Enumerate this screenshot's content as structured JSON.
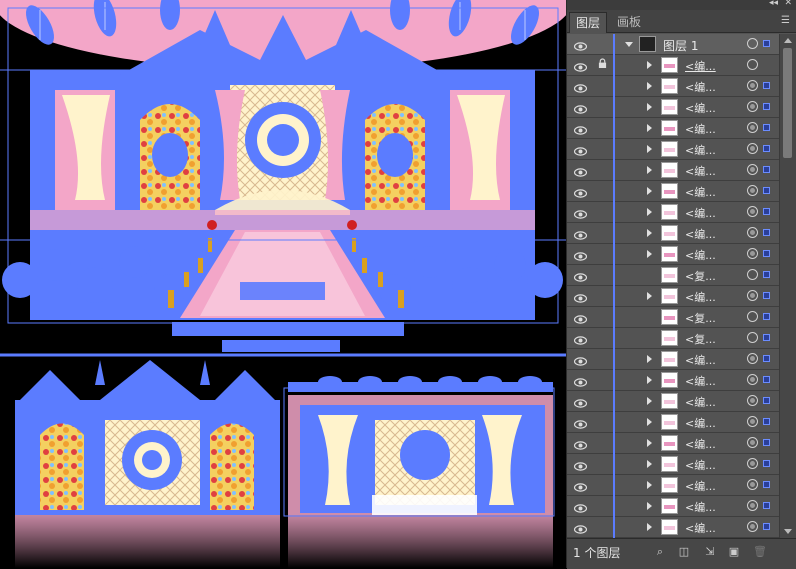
{
  "panel": {
    "tabs": [
      {
        "label": "图层"
      },
      {
        "label": "画板"
      }
    ],
    "window_controls": {
      "collapse": "◂◂",
      "close": "✕"
    },
    "menu_icon": "panel-menu-icon",
    "top_layer": {
      "name": "图层  1"
    },
    "rows": [
      {
        "label": "<编...",
        "locked": true,
        "target": "empty",
        "selected": false,
        "expandable": true,
        "underline": true
      },
      {
        "label": "<编...",
        "locked": false,
        "target": "filled",
        "selected": true,
        "expandable": true,
        "underline": false
      },
      {
        "label": "<编...",
        "locked": false,
        "target": "filled",
        "selected": true,
        "expandable": true,
        "underline": false
      },
      {
        "label": "<编...",
        "locked": false,
        "target": "filled",
        "selected": true,
        "expandable": true,
        "underline": false
      },
      {
        "label": "<编...",
        "locked": false,
        "target": "filled",
        "selected": true,
        "expandable": true,
        "underline": false
      },
      {
        "label": "<编...",
        "locked": false,
        "target": "filled",
        "selected": true,
        "expandable": true,
        "underline": false
      },
      {
        "label": "<编...",
        "locked": false,
        "target": "filled",
        "selected": true,
        "expandable": true,
        "underline": false
      },
      {
        "label": "<编...",
        "locked": false,
        "target": "filled",
        "selected": true,
        "expandable": true,
        "underline": false
      },
      {
        "label": "<编...",
        "locked": false,
        "target": "filled",
        "selected": true,
        "expandable": true,
        "underline": false
      },
      {
        "label": "<编...",
        "locked": false,
        "target": "filled",
        "selected": true,
        "expandable": true,
        "underline": false
      },
      {
        "label": "<复...",
        "locked": false,
        "target": "empty",
        "selected": true,
        "expandable": false,
        "underline": false
      },
      {
        "label": "<编...",
        "locked": false,
        "target": "filled",
        "selected": true,
        "expandable": true,
        "underline": false
      },
      {
        "label": "<复...",
        "locked": false,
        "target": "empty",
        "selected": true,
        "expandable": false,
        "underline": false
      },
      {
        "label": "<复...",
        "locked": false,
        "target": "empty",
        "selected": true,
        "expandable": false,
        "underline": false
      },
      {
        "label": "<编...",
        "locked": false,
        "target": "filled",
        "selected": true,
        "expandable": true,
        "underline": false
      },
      {
        "label": "<编...",
        "locked": false,
        "target": "filled",
        "selected": true,
        "expandable": true,
        "underline": false
      },
      {
        "label": "<编...",
        "locked": false,
        "target": "filled",
        "selected": true,
        "expandable": true,
        "underline": false
      },
      {
        "label": "<编...",
        "locked": false,
        "target": "filled",
        "selected": true,
        "expandable": true,
        "underline": false
      },
      {
        "label": "<编...",
        "locked": false,
        "target": "filled",
        "selected": true,
        "expandable": true,
        "underline": false
      },
      {
        "label": "<编...",
        "locked": false,
        "target": "filled",
        "selected": true,
        "expandable": true,
        "underline": false
      },
      {
        "label": "<编...",
        "locked": false,
        "target": "filled",
        "selected": true,
        "expandable": true,
        "underline": false
      },
      {
        "label": "<编...",
        "locked": false,
        "target": "filled",
        "selected": true,
        "expandable": true,
        "underline": false
      },
      {
        "label": "<编...",
        "locked": false,
        "target": "filled",
        "selected": true,
        "expandable": true,
        "underline": false
      }
    ],
    "footer": {
      "count_label": "1 个图层",
      "icons": [
        "locate-object-icon",
        "make-clipping-mask-icon",
        "new-sublayer-icon",
        "new-layer-icon",
        "delete-layer-icon"
      ]
    }
  },
  "colors": {
    "selection": "#5b7cff",
    "panel_bg": "#535353",
    "pink": "#f3a6c8",
    "cream": "#fff2c7"
  }
}
